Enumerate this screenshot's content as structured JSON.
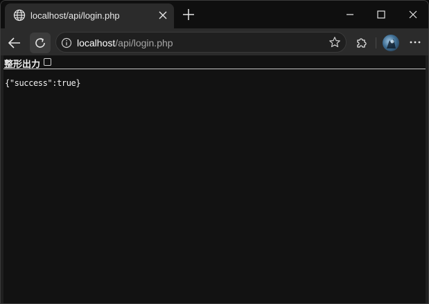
{
  "tab": {
    "title": "localhost/api/login.php",
    "favicon": "globe-icon"
  },
  "address_bar": {
    "host": "localhost",
    "path": "/api/login.php"
  },
  "page": {
    "pretty_print_label": "整形出力",
    "pretty_print_checked": false,
    "json_text": "{\"success\":true}"
  },
  "colors": {
    "tab_bg": "#2b2b2b",
    "page_bg": "#121212",
    "text": "#f2f2f2"
  }
}
